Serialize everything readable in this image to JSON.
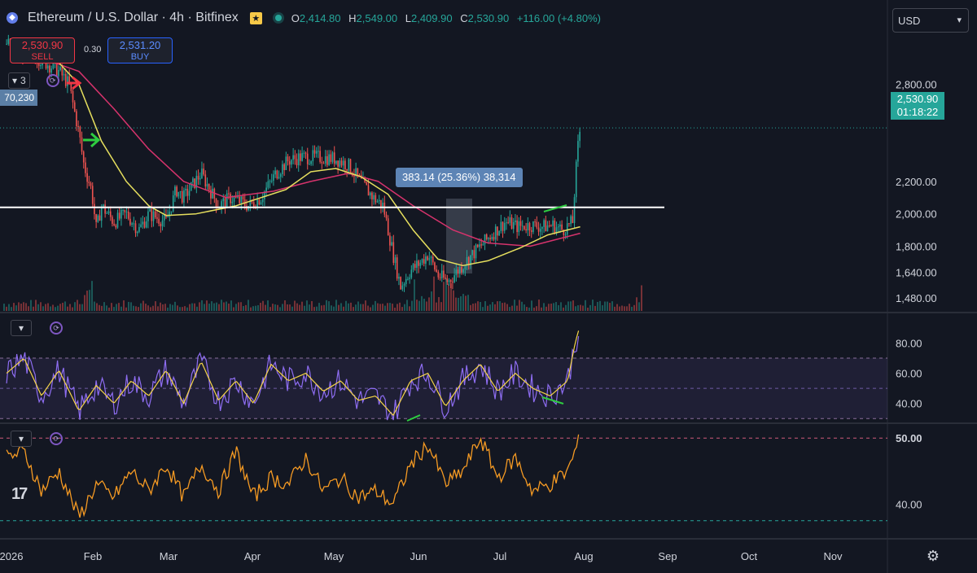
{
  "header": {
    "symbol_icon": "ethereum-icon",
    "title": "Ethereum / U.S. Dollar · 4h · Bitfinex",
    "ohlc": {
      "o_label": "O",
      "o": "2,414.80",
      "h_label": "H",
      "h": "2,549.00",
      "l_label": "L",
      "l": "2,409.90",
      "c_label": "C",
      "c": "2,530.90",
      "change": "+116.00 (+4.80%)"
    }
  },
  "trade": {
    "sell_price": "2,530.90",
    "sell_label": "SELL",
    "buy_price": "2,531.20",
    "buy_label": "BUY",
    "spread": "0.30"
  },
  "currency": "USD",
  "indicator_count": "3",
  "left_tag": "70,230",
  "measure_label": "383.14 (25.36%) 38,314",
  "last_price": {
    "price": "2,530.90",
    "countdown": "01:18:22"
  },
  "colors": {
    "bg": "#131722",
    "up": "#26a69a",
    "down": "#ef5350",
    "ma_fast": "#e6df5e",
    "ma_slow": "#d6336c",
    "rsi": "#8e6df2",
    "rsi_ma": "#f5d547",
    "osc": "#f59a23"
  },
  "chart_data": [
    {
      "type": "candlestick",
      "pane": "price",
      "x_labels": [
        "2026",
        "Feb",
        "Mar",
        "Apr",
        "May",
        "Jun",
        "Jul",
        "Aug",
        "Sep",
        "Oct",
        "Nov"
      ],
      "y_ticks": [
        "2,800.00",
        "2,200.00",
        "2,000.00",
        "1,800.00",
        "1,640.00",
        "1,480.00"
      ],
      "ylim": [
        1400,
        3100
      ],
      "path": [
        [
          "Jan 03",
          3050
        ],
        [
          "Jan 10",
          3000
        ],
        [
          "Jan 17",
          2950
        ],
        [
          "Jan 24",
          2880
        ],
        [
          "Jan 28",
          2800
        ],
        [
          "Feb 01",
          2500
        ],
        [
          "Feb 03",
          2300
        ],
        [
          "Feb 06",
          2150
        ],
        [
          "Feb 08",
          1900
        ],
        [
          "Feb 10",
          2050
        ],
        [
          "Feb 15",
          1950
        ],
        [
          "Feb 20",
          2000
        ],
        [
          "Feb 25",
          1900
        ],
        [
          "Mar 01",
          2000
        ],
        [
          "Mar 08",
          1950
        ],
        [
          "Mar 12",
          2150
        ],
        [
          "Mar 15",
          2100
        ],
        [
          "Mar 22",
          2250
        ],
        [
          "Mar 29",
          2050
        ],
        [
          "Apr 03",
          2100
        ],
        [
          "Apr 10",
          2050
        ],
        [
          "Apr 15",
          2100
        ],
        [
          "Apr 21",
          2250
        ],
        [
          "Apr 26",
          2330
        ],
        [
          "May 01",
          2350
        ],
        [
          "May 08",
          2350
        ],
        [
          "May 15",
          2340
        ],
        [
          "May 20",
          2300
        ],
        [
          "May 25",
          2200
        ],
        [
          "May 30",
          2100
        ],
        [
          "Jun 03",
          2050
        ],
        [
          "Jun 07",
          1750
        ],
        [
          "Jun 10",
          1550
        ],
        [
          "Jun 14",
          1650
        ],
        [
          "Jun 18",
          1700
        ],
        [
          "Jun 21",
          1750
        ],
        [
          "Jun 25",
          1620
        ],
        [
          "Jun 29",
          1580
        ],
        [
          "Jul 03",
          1650
        ],
        [
          "Jul 07",
          1720
        ],
        [
          "Jul 12",
          1800
        ],
        [
          "Jul 17",
          1880
        ],
        [
          "Jul 22",
          1950
        ],
        [
          "Jul 27",
          1920
        ],
        [
          "Aug 01",
          1930
        ],
        [
          "Aug 06",
          1920
        ],
        [
          "Aug 10",
          1930
        ],
        [
          "Aug 14",
          1900
        ],
        [
          "Aug 18",
          1950
        ],
        [
          "Aug 19",
          2200
        ],
        [
          "Aug 20",
          2400
        ],
        [
          "Aug 21",
          2530
        ]
      ],
      "ma_fast": [
        [
          "Jan 20",
          3000
        ],
        [
          "Feb 01",
          2800
        ],
        [
          "Feb 10",
          2450
        ],
        [
          "Feb 20",
          2200
        ],
        [
          "Mar 01",
          2050
        ],
        [
          "Mar 08",
          1990
        ],
        [
          "Mar 20",
          2000
        ],
        [
          "Apr 05",
          2050
        ],
        [
          "Apr 25",
          2150
        ],
        [
          "May 05",
          2260
        ],
        [
          "May 15",
          2280
        ],
        [
          "May 25",
          2230
        ],
        [
          "Jun 05",
          2120
        ],
        [
          "Jun 15",
          1900
        ],
        [
          "Jun 25",
          1720
        ],
        [
          "Jul 05",
          1680
        ],
        [
          "Jul 15",
          1710
        ],
        [
          "Jul 28",
          1790
        ],
        [
          "Aug 08",
          1870
        ],
        [
          "Aug 21",
          1920
        ]
      ],
      "ma_slow": [
        [
          "Jan 10",
          3000
        ],
        [
          "Feb 01",
          2880
        ],
        [
          "Feb 15",
          2650
        ],
        [
          "Mar 01",
          2400
        ],
        [
          "Mar 15",
          2200
        ],
        [
          "Apr 01",
          2100
        ],
        [
          "Apr 20",
          2140
        ],
        [
          "May 05",
          2200
        ],
        [
          "May 20",
          2250
        ],
        [
          "Jun 01",
          2200
        ],
        [
          "Jun 15",
          2050
        ],
        [
          "Jul 01",
          1900
        ],
        [
          "Jul 15",
          1820
        ],
        [
          "Aug 01",
          1800
        ],
        [
          "Aug 21",
          1880
        ]
      ],
      "hline": 2040,
      "last": 2530.9
    },
    {
      "type": "line",
      "pane": "rsi",
      "y_ticks": [
        "80.00",
        "60.00",
        "40.00"
      ],
      "ylim": [
        28,
        98
      ],
      "bands": [
        70,
        50,
        30
      ],
      "path": [
        [
          "Jan 03",
          60
        ],
        [
          "Jan 10",
          70
        ],
        [
          "Jan 17",
          45
        ],
        [
          "Jan 24",
          62
        ],
        [
          "Feb 01",
          35
        ],
        [
          "Feb 08",
          52
        ],
        [
          "Feb 15",
          40
        ],
        [
          "Feb 22",
          55
        ],
        [
          "Mar 01",
          45
        ],
        [
          "Mar 08",
          62
        ],
        [
          "Mar 15",
          40
        ],
        [
          "Mar 22",
          68
        ],
        [
          "Mar 29",
          42
        ],
        [
          "Apr 05",
          55
        ],
        [
          "Apr 12",
          40
        ],
        [
          "Apr 19",
          66
        ],
        [
          "Apr 26",
          55
        ],
        [
          "May 03",
          60
        ],
        [
          "May 10",
          48
        ],
        [
          "May 17",
          55
        ],
        [
          "May 24",
          42
        ],
        [
          "May 31",
          45
        ],
        [
          "Jun 07",
          32
        ],
        [
          "Jun 14",
          55
        ],
        [
          "Jun 21",
          60
        ],
        [
          "Jun 28",
          38
        ],
        [
          "Jul 05",
          55
        ],
        [
          "Jul 12",
          66
        ],
        [
          "Jul 19",
          48
        ],
        [
          "Jul 26",
          60
        ],
        [
          "Aug 02",
          50
        ],
        [
          "Aug 09",
          45
        ],
        [
          "Aug 16",
          55
        ],
        [
          "Aug 19",
          80
        ],
        [
          "Aug 21",
          92
        ]
      ]
    },
    {
      "type": "line",
      "pane": "oscillator",
      "y_ticks": [
        "50.00",
        "40.00"
      ],
      "ylim": [
        35,
        52
      ],
      "bands": [
        50,
        37.5
      ],
      "path": [
        [
          "Jan 03",
          47
        ],
        [
          "Jan 10",
          48
        ],
        [
          "Jan 17",
          42
        ],
        [
          "Jan 24",
          45
        ],
        [
          "Feb 01",
          38
        ],
        [
          "Feb 08",
          43
        ],
        [
          "Feb 15",
          41
        ],
        [
          "Feb 22",
          45
        ],
        [
          "Mar 01",
          42
        ],
        [
          "Mar 08",
          46
        ],
        [
          "Mar 15",
          41
        ],
        [
          "Mar 22",
          46
        ],
        [
          "Mar 29",
          42
        ],
        [
          "Apr 05",
          48
        ],
        [
          "Apr 12",
          41
        ],
        [
          "Apr 19",
          44
        ],
        [
          "Apr 26",
          43
        ],
        [
          "May 03",
          47
        ],
        [
          "May 10",
          42
        ],
        [
          "May 17",
          44
        ],
        [
          "May 24",
          41
        ],
        [
          "May 31",
          42
        ],
        [
          "Jun 07",
          40
        ],
        [
          "Jun 14",
          46
        ],
        [
          "Jun 21",
          49
        ],
        [
          "Jun 28",
          43
        ],
        [
          "Jul 05",
          45
        ],
        [
          "Jul 12",
          50
        ],
        [
          "Jul 19",
          44
        ],
        [
          "Jul 26",
          47
        ],
        [
          "Aug 02",
          42
        ],
        [
          "Aug 09",
          43
        ],
        [
          "Aug 16",
          45
        ],
        [
          "Aug 21",
          50
        ]
      ]
    }
  ]
}
